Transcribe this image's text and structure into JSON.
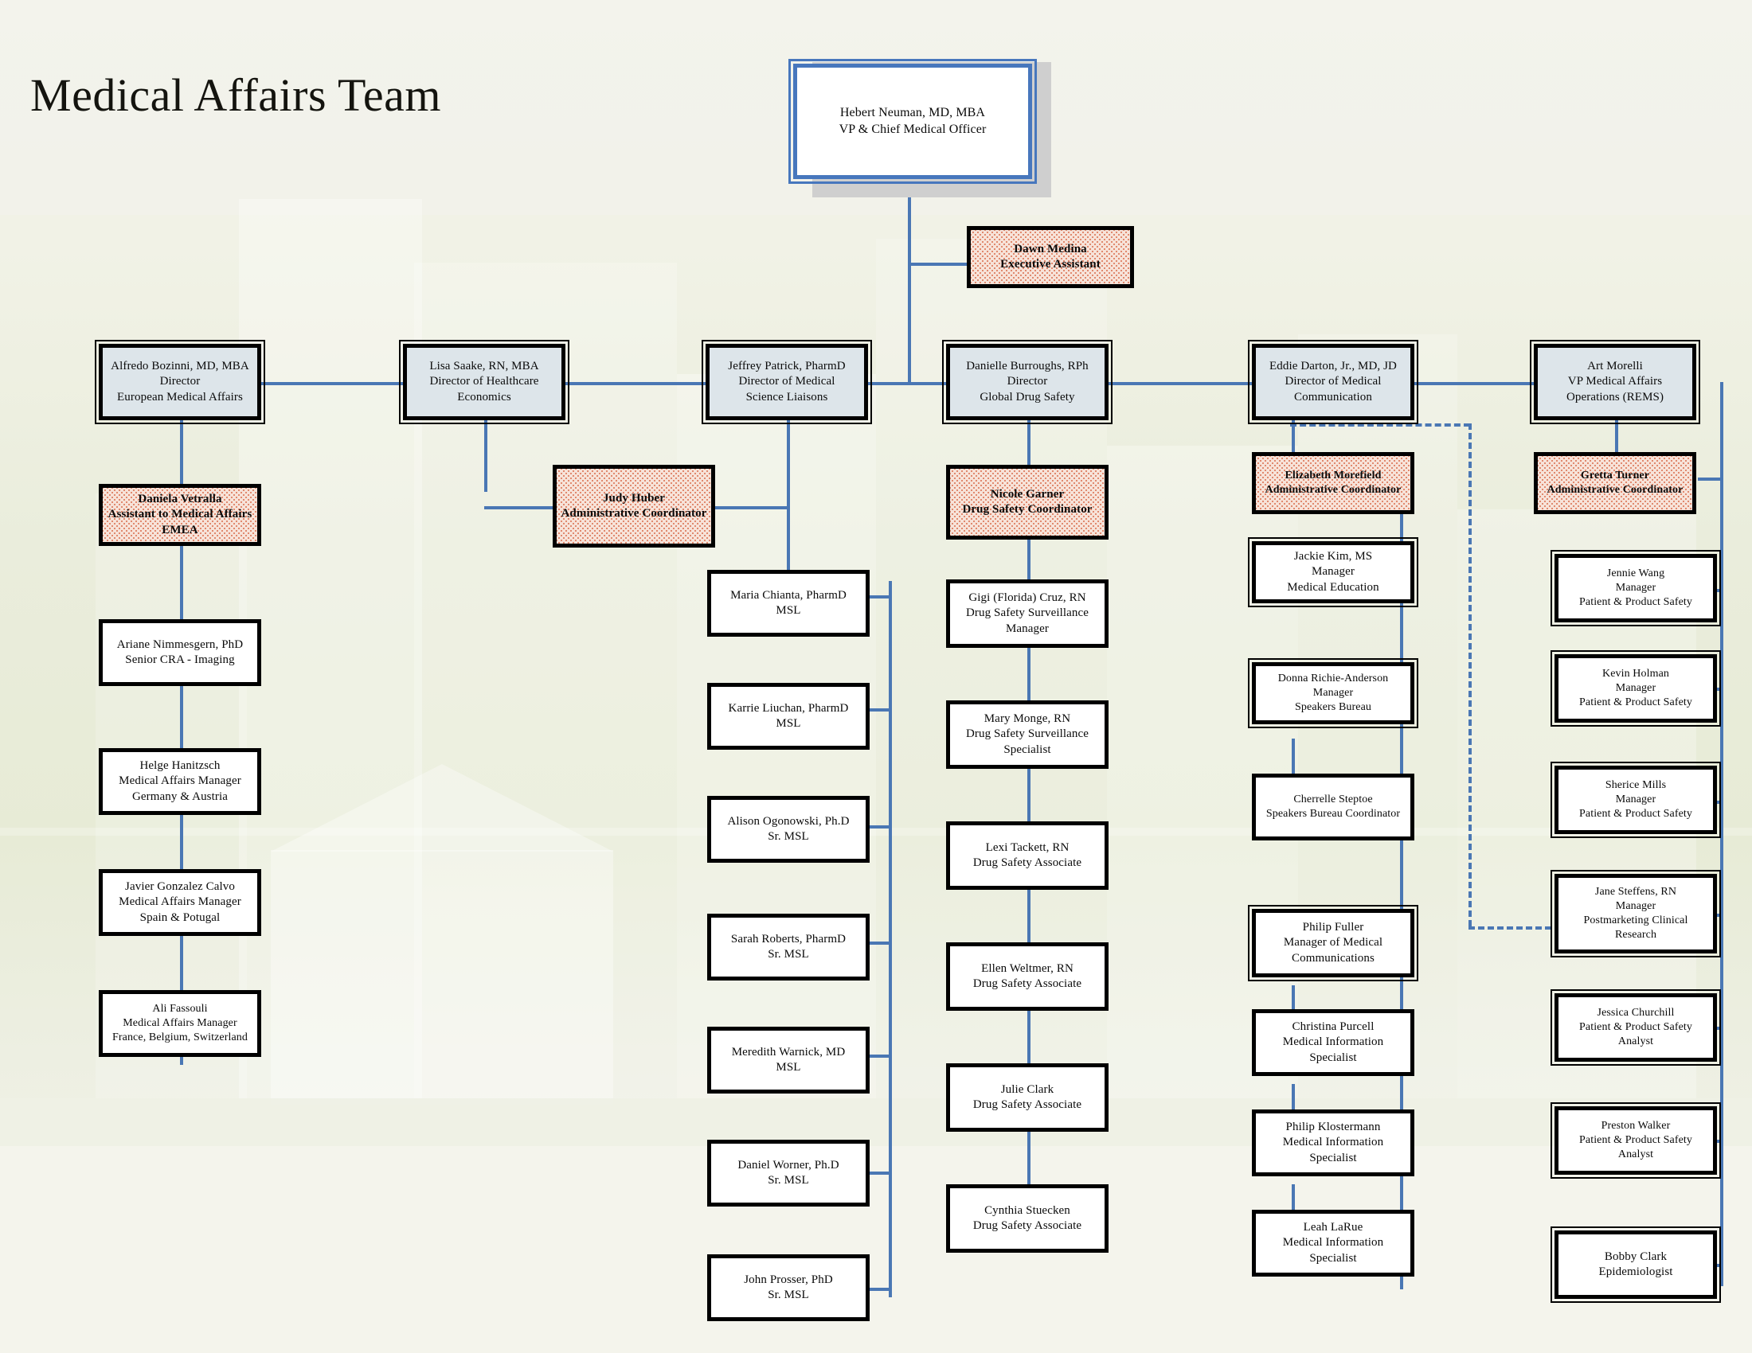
{
  "page": {
    "title": "Medical Affairs Team",
    "background_color": "#f2f2e8",
    "connector_color": "#4a77b4",
    "director_fill": "#dde5ea",
    "assistant_fill": "#f7e3d9",
    "executive_border": "#4777bd"
  },
  "executive": {
    "name": "Hebert Neuman, MD, MBA",
    "role": "VP & Chief Medical Officer"
  },
  "executive_assistant": {
    "name": "Dawn Medina",
    "role": "Executive Assistant"
  },
  "directors": [
    {
      "name": "Alfredo Bozinni, MD, MBA",
      "role1": "Director",
      "role2": "European Medical Affairs"
    },
    {
      "name": "Lisa Saake, RN, MBA",
      "role1": "Director of Healthcare",
      "role2": "Economics"
    },
    {
      "name": "Jeffrey Patrick, PharmD",
      "role1": "Director of Medical",
      "role2": "Science Liaisons"
    },
    {
      "name": "Danielle Burroughs, RPh",
      "role1": "Director",
      "role2": "Global Drug Safety"
    },
    {
      "name": "Eddie Darton, Jr., MD, JD",
      "role1": "Director of Medical",
      "role2": "Communication"
    },
    {
      "name": "Art Morelli",
      "role1": "VP Medical Affairs",
      "role2": "Operations (REMS)"
    }
  ],
  "assistants": [
    {
      "name": "Daniela Vetralla",
      "role1": "Assistant to Medical Affairs",
      "role2": "EMEA"
    },
    {
      "name": "Judy Huber",
      "role1": "Administrative Coordinator",
      "role2": ""
    },
    {
      "name": "Nicole Garner",
      "role1": "Drug Safety Coordinator",
      "role2": ""
    },
    {
      "name": "Elizabeth Morefield",
      "role1": "Administrative Coordinator",
      "role2": ""
    },
    {
      "name": "Gretta Turner",
      "role1": "Administrative Coordinator",
      "role2": ""
    }
  ],
  "columns": {
    "european_medical_affairs": [
      {
        "name": "Ariane Nimmesgern, PhD",
        "role1": "Senior CRA - Imaging",
        "role2": "",
        "role3": ""
      },
      {
        "name": "Helge Hanitzsch",
        "role1": "Medical Affairs Manager",
        "role2": "Germany & Austria",
        "role3": ""
      },
      {
        "name": "Javier Gonzalez Calvo",
        "role1": "Medical Affairs Manager",
        "role2": "Spain & Potugal",
        "role3": ""
      },
      {
        "name": "Ali Fassouli",
        "role1": "Medical Affairs Manager",
        "role2": "France, Belgium, Switzerland",
        "role3": ""
      }
    ],
    "medical_science_liaisons": [
      {
        "name": "Maria Chianta, PharmD",
        "role1": "MSL",
        "role2": "",
        "role3": ""
      },
      {
        "name": "Karrie Liuchan, PharmD",
        "role1": "MSL",
        "role2": "",
        "role3": ""
      },
      {
        "name": "Alison Ogonowski, Ph.D",
        "role1": "Sr. MSL",
        "role2": "",
        "role3": ""
      },
      {
        "name": "Sarah Roberts, PharmD",
        "role1": "Sr. MSL",
        "role2": "",
        "role3": ""
      },
      {
        "name": "Meredith Warnick, MD",
        "role1": "MSL",
        "role2": "",
        "role3": ""
      },
      {
        "name": "Daniel Worner, Ph.D",
        "role1": "Sr. MSL",
        "role2": "",
        "role3": ""
      },
      {
        "name": "John Prosser, PhD",
        "role1": "Sr. MSL",
        "role2": "",
        "role3": ""
      }
    ],
    "global_drug_safety": [
      {
        "name": "Gigi (Florida) Cruz, RN",
        "role1": "Drug Safety Surveillance",
        "role2": "Manager",
        "role3": ""
      },
      {
        "name": "Mary Monge, RN",
        "role1": "Drug Safety Surveillance",
        "role2": "Specialist",
        "role3": ""
      },
      {
        "name": "Lexi Tackett, RN",
        "role1": "Drug Safety Associate",
        "role2": "",
        "role3": ""
      },
      {
        "name": "Ellen Weltmer, RN",
        "role1": "Drug Safety Associate",
        "role2": "",
        "role3": ""
      },
      {
        "name": "Julie Clark",
        "role1": "Drug Safety Associate",
        "role2": "",
        "role3": ""
      },
      {
        "name": "Cynthia Stuecken",
        "role1": "Drug Safety Associate",
        "role2": "",
        "role3": ""
      }
    ],
    "medical_communication": [
      {
        "name": "Jackie Kim, MS",
        "role1": "Manager",
        "role2": "Medical Education",
        "role3": "",
        "style": "manager"
      },
      {
        "name": "Donna Richie-Anderson",
        "role1": "Manager",
        "role2": "Speakers Bureau",
        "role3": "",
        "style": "manager"
      },
      {
        "name": "Cherrelle Steptoe",
        "role1": "Speakers Bureau Coordinator",
        "role2": "",
        "role3": "",
        "style": "staff"
      },
      {
        "name": "Philip Fuller",
        "role1": "Manager of Medical",
        "role2": "Communications",
        "role3": "",
        "style": "manager"
      },
      {
        "name": "Christina Purcell",
        "role1": "Medical Information",
        "role2": "Specialist",
        "role3": "",
        "style": "staff"
      },
      {
        "name": "Philip Klostermann",
        "role1": "Medical Information",
        "role2": "Specialist",
        "role3": "",
        "style": "staff"
      },
      {
        "name": "Leah LaRue",
        "role1": "Medical Information",
        "role2": "Specialist",
        "role3": "",
        "style": "staff"
      }
    ],
    "medical_affairs_operations": [
      {
        "name": "Jennie Wang",
        "role1": "Manager",
        "role2": "Patient & Product Safety",
        "role3": "",
        "style": "manager"
      },
      {
        "name": "Kevin Holman",
        "role1": "Manager",
        "role2": "Patient & Product Safety",
        "role3": "",
        "style": "manager"
      },
      {
        "name": "Sherice Mills",
        "role1": "Manager",
        "role2": "Patient & Product Safety",
        "role3": "",
        "style": "manager"
      },
      {
        "name": "Jane Steffens, RN",
        "role1": "Manager",
        "role2": "Postmarketing Clinical",
        "role3": "Research",
        "style": "manager"
      },
      {
        "name": "Jessica Churchill",
        "role1": "Patient & Product Safety",
        "role2": "Analyst",
        "role3": "",
        "style": "manager"
      },
      {
        "name": "Preston Walker",
        "role1": "Patient & Product Safety",
        "role2": "Analyst",
        "role3": "",
        "style": "manager"
      },
      {
        "name": "Bobby Clark",
        "role1": "Epidemiologist",
        "role2": "",
        "role3": "",
        "style": "manager"
      }
    ]
  }
}
